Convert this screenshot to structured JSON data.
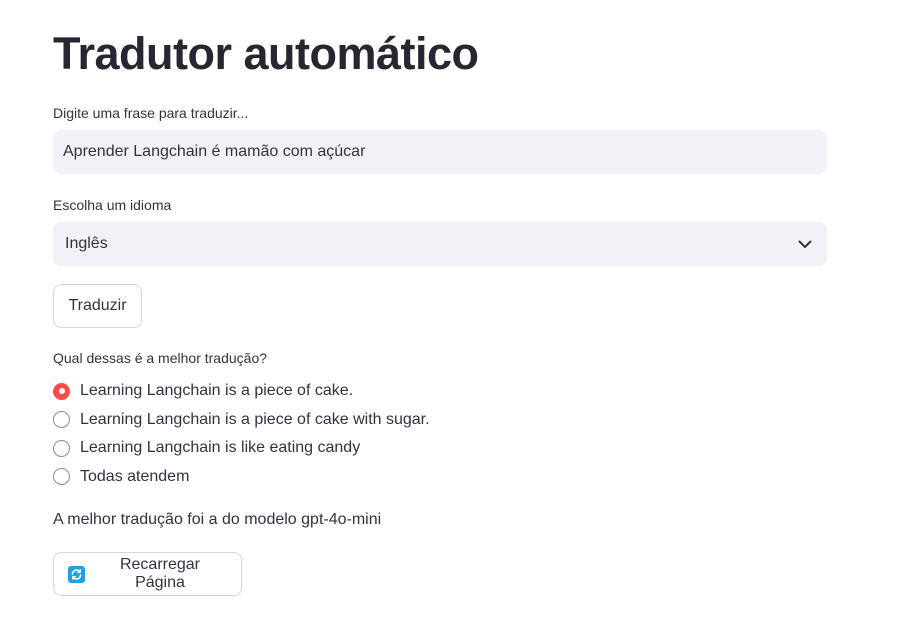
{
  "title": "Tradutor automático",
  "phrase": {
    "label": "Digite uma frase para traduzir...",
    "value": "Aprender Langchain é mamão com açúcar"
  },
  "language": {
    "label": "Escolha um idioma",
    "selected": "Inglês",
    "icon": "chevron-down-icon"
  },
  "translate_button": {
    "label": "Traduzir"
  },
  "question": {
    "label": "Qual dessas é a melhor tradução?",
    "options": [
      {
        "label": "Learning Langchain is a piece of cake.",
        "selected": true
      },
      {
        "label": "Learning Langchain is a piece of cake with sugar.",
        "selected": false
      },
      {
        "label": "Learning Langchain is like eating candy",
        "selected": false
      },
      {
        "label": "Todas atendem",
        "selected": false
      }
    ]
  },
  "result": {
    "text": "A melhor tradução foi a do modelo gpt-4o-mini"
  },
  "reload_button": {
    "label": "Recarregar Página",
    "icon": "reload-icon"
  },
  "colors": {
    "accent": "#ff4b4b",
    "input_bg": "#f0f2f6",
    "text": "#31333f",
    "reload_icon": "#1ca0e6"
  }
}
